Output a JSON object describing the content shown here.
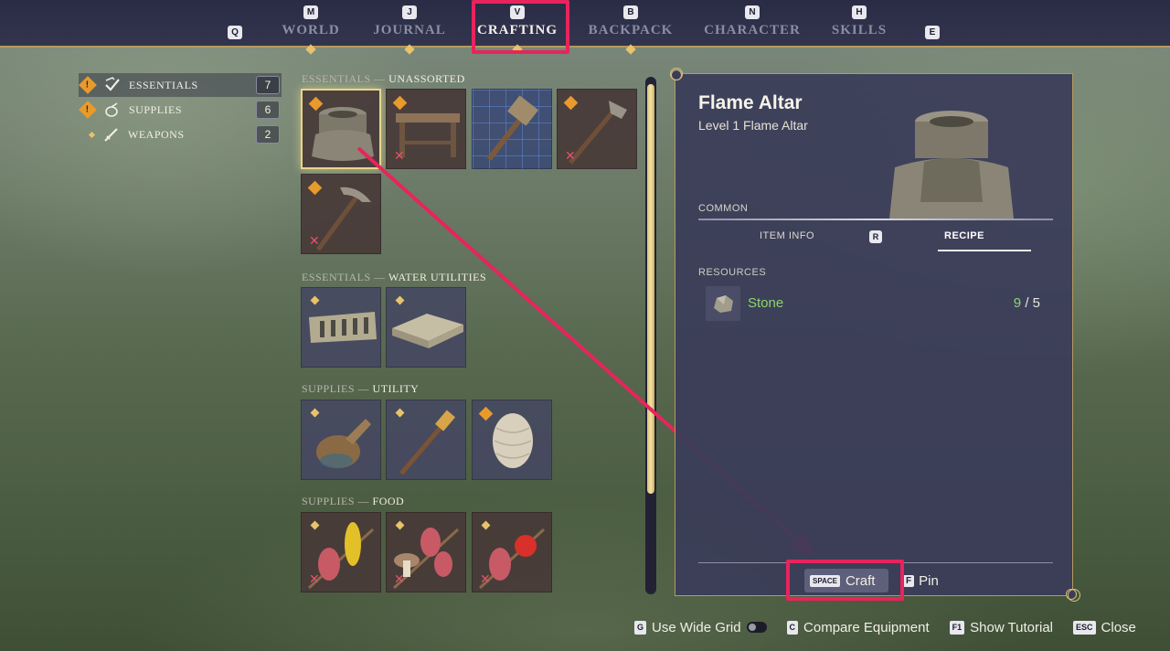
{
  "nav": {
    "left_key": "Q",
    "right_key": "E",
    "tabs": [
      {
        "key": "M",
        "label": "WORLD"
      },
      {
        "key": "J",
        "label": "JOURNAL"
      },
      {
        "key": "V",
        "label": "CRAFTING"
      },
      {
        "key": "B",
        "label": "BACKPACK"
      },
      {
        "key": "N",
        "label": "CHARACTER"
      },
      {
        "key": "H",
        "label": "SKILLS"
      }
    ],
    "active_tab": "CRAFTING"
  },
  "categories": [
    {
      "label": "ESSENTIALS",
      "count": "7",
      "icon": "checkmark-crest-icon",
      "alert": "!"
    },
    {
      "label": "SUPPLIES",
      "count": "6",
      "icon": "pouch-icon",
      "alert": "!"
    },
    {
      "label": "WEAPONS",
      "count": "2",
      "icon": "sword-icon",
      "alert": ""
    }
  ],
  "sections": [
    {
      "prefix": "ESSENTIALS —",
      "name": "UNASSORTED"
    },
    {
      "prefix": "ESSENTIALS —",
      "name": "WATER UTILITIES"
    },
    {
      "prefix": "SUPPLIES —",
      "name": "UTILITY"
    },
    {
      "prefix": "SUPPLIES —",
      "name": "FOOD"
    }
  ],
  "grid": {
    "cross_mark": "✕",
    "alert_mark": "!",
    "items": [
      {
        "name": "flame-altar",
        "icon": "stone-altar-icon"
      },
      {
        "name": "workbench",
        "icon": "workbench-icon"
      },
      {
        "name": "hammer",
        "icon": "hammer-icon"
      },
      {
        "name": "axe",
        "icon": "axe-icon"
      },
      {
        "name": "pickaxe",
        "icon": "pickaxe-icon"
      },
      {
        "name": "water-trough",
        "icon": "brick-trough-icon"
      },
      {
        "name": "water-basin",
        "icon": "brick-basin-icon"
      },
      {
        "name": "waterskin",
        "icon": "waterskin-icon"
      },
      {
        "name": "torch",
        "icon": "torch-icon"
      },
      {
        "name": "twine",
        "icon": "twine-ball-icon"
      },
      {
        "name": "meat-corn-skewer",
        "icon": "meat-corn-skewer-icon"
      },
      {
        "name": "meat-mushroom-skewer",
        "icon": "meat-mushroom-skewer-icon"
      },
      {
        "name": "meat-tomato-skewer",
        "icon": "meat-tomato-skewer-icon"
      }
    ]
  },
  "detail": {
    "title": "Flame Altar",
    "subtitle": "Level 1 Flame Altar",
    "rarity": "COMMON",
    "tabs": {
      "item_info": "ITEM INFO",
      "key": "R",
      "recipe": "RECIPE"
    },
    "resources_title": "RESOURCES",
    "resources": [
      {
        "name": "Stone",
        "have": "9",
        "separator": "/",
        "need": "5",
        "icon": "stone-icon"
      }
    ],
    "craft": {
      "key": "SPACE",
      "label": "Craft"
    },
    "pin": {
      "key": "F",
      "label": "Pin"
    }
  },
  "hints": [
    {
      "key": "G",
      "label": "Use Wide Grid"
    },
    {
      "key": "C",
      "label": "Compare Equipment"
    },
    {
      "key": "F1",
      "label": "Show Tutorial"
    },
    {
      "key": "ESC",
      "label": "Close"
    }
  ],
  "colors": {
    "highlight": "#e8245c",
    "accent_gold": "#e8c36a",
    "resource_ok": "#8fd46c",
    "panel_bg": "#3a3c58"
  }
}
